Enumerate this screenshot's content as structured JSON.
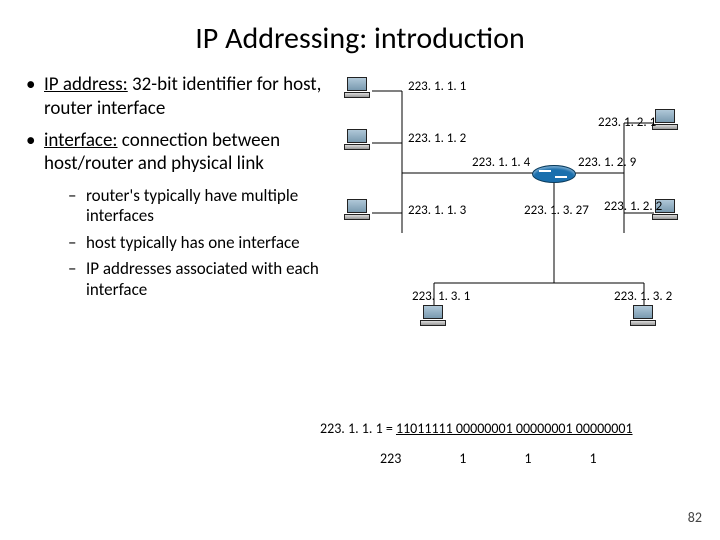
{
  "title": "IP Addressing: introduction",
  "bullets": [
    {
      "label_prefix": "IP address:",
      "label_rest": " 32-bit identifier for host, router interface"
    },
    {
      "label_prefix": "interface:",
      "label_rest": " connection between host/router and physical link"
    }
  ],
  "subbullets": [
    "router's typically have multiple interfaces",
    "host typically has one interface",
    "IP addresses associated with each interface"
  ],
  "diagram": {
    "hosts": {
      "h1": "223. 1. 1. 1",
      "h2": "223. 1. 1. 2",
      "h3": "223. 1. 1. 3",
      "h4": "223. 1. 2. 1",
      "h5": "223. 1. 2. 2",
      "h6": "223. 1. 3. 1",
      "h7": "223. 1. 3. 2"
    },
    "router_ifaces": {
      "r1": "223. 1. 1. 4",
      "r2": "223. 1. 2. 9",
      "r3": "223. 1. 3. 27"
    }
  },
  "binary": {
    "prefix": "223. 1. 1. 1 = ",
    "bits": "11011111 00000001 00000001 00000001",
    "octets": [
      "223",
      "1",
      "1",
      "1"
    ]
  },
  "page_number": "82"
}
